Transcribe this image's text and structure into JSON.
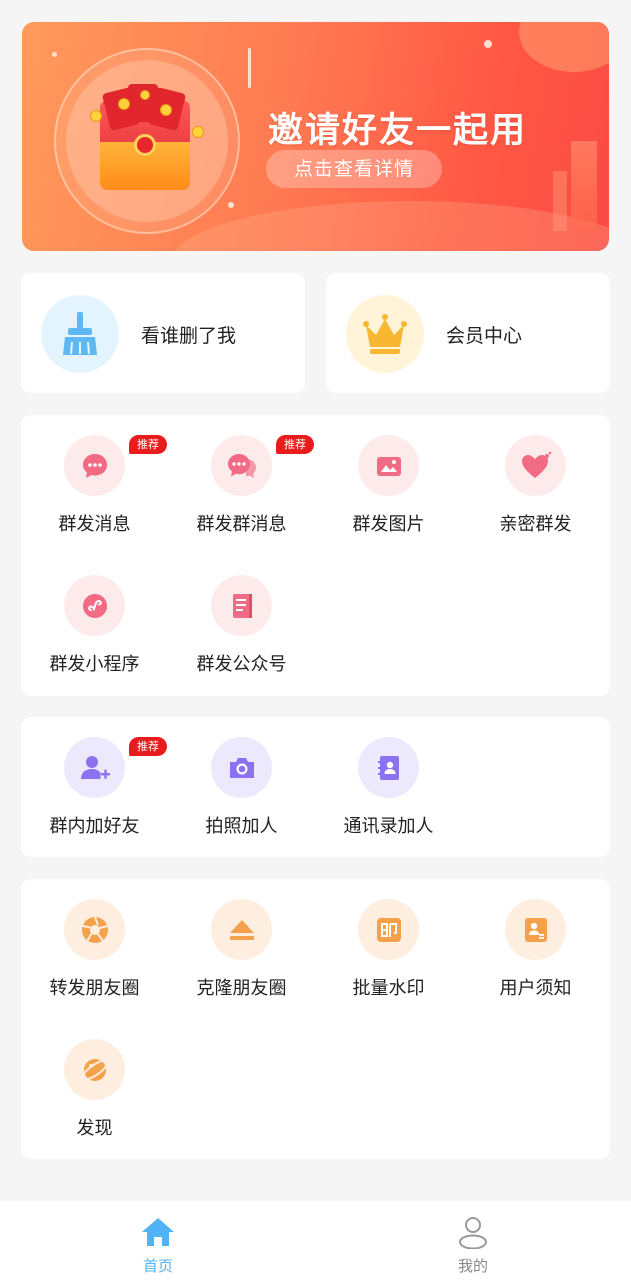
{
  "banner": {
    "title": "邀请好友一起用",
    "button_label": "点击查看详情"
  },
  "quick": [
    {
      "label": "看谁删了我",
      "icon": "broom-icon"
    },
    {
      "label": "会员中心",
      "icon": "crown-icon"
    }
  ],
  "section1": [
    {
      "label": "群发消息",
      "icon": "chat-bubble-icon",
      "badge": "推荐"
    },
    {
      "label": "群发群消息",
      "icon": "group-chat-icon",
      "badge": "推荐"
    },
    {
      "label": "群发图片",
      "icon": "image-icon"
    },
    {
      "label": "亲密群发",
      "icon": "heart-icon"
    },
    {
      "label": "群发小程序",
      "icon": "mini-program-icon"
    },
    {
      "label": "群发公众号",
      "icon": "official-account-icon"
    }
  ],
  "section2": [
    {
      "label": "群内加好友",
      "icon": "add-user-icon",
      "badge": "推荐"
    },
    {
      "label": "拍照加人",
      "icon": "camera-icon"
    },
    {
      "label": "通讯录加人",
      "icon": "contacts-book-icon"
    }
  ],
  "section3": [
    {
      "label": "转发朋友圈",
      "icon": "aperture-icon"
    },
    {
      "label": "克隆朋友圈",
      "icon": "eject-icon"
    },
    {
      "label": "批量水印",
      "icon": "stamp-icon"
    },
    {
      "label": "用户须知",
      "icon": "user-card-icon"
    },
    {
      "label": "发现",
      "icon": "planet-icon"
    }
  ],
  "tabbar": {
    "home": "首页",
    "mine": "我的"
  },
  "colors": {
    "accent_blue": "#4fb3f5",
    "badge_red": "#e81c1c",
    "banner_start": "#ff9a5c",
    "banner_end": "#fa4a44"
  }
}
